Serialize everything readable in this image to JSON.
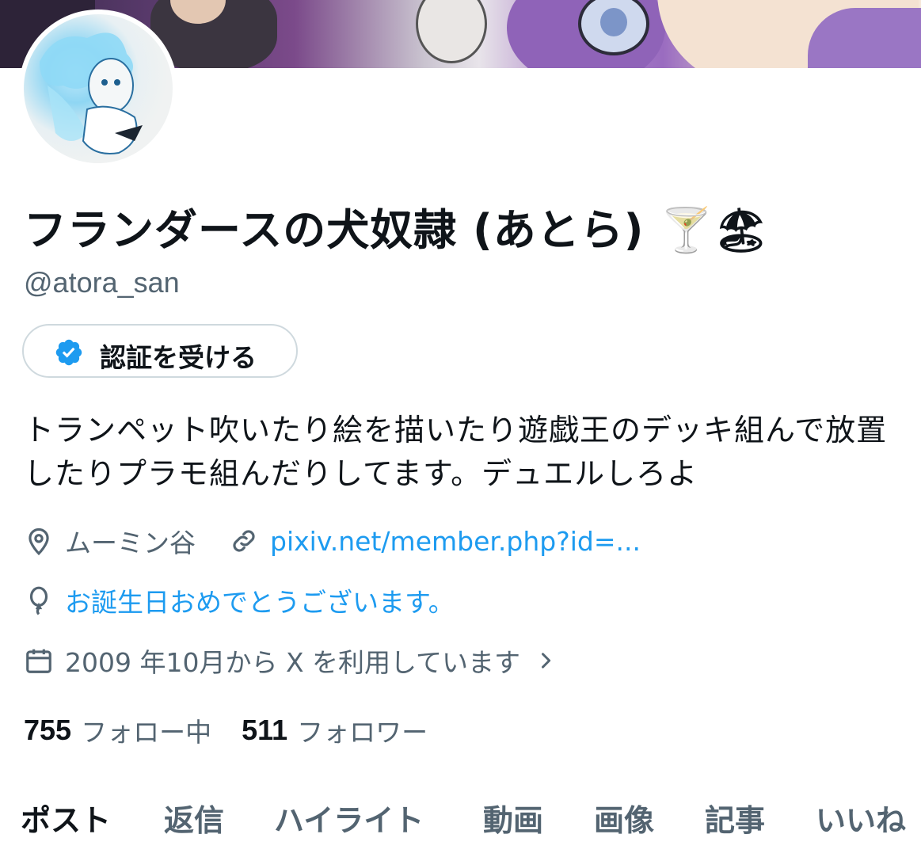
{
  "profile": {
    "display_name": "フランダースの犬奴隷 (あとら) 🍸🏖",
    "handle": "@atora_san",
    "verify_button_label": "認証を受ける",
    "bio": "トランペット吹いたり絵を描いたり遊戯王のデッキ組んで放置したりプラモ組んだりしてます。デュエルしろよ",
    "location": "ムーミン谷",
    "website": "pixiv.net/member.php?id=...",
    "birthday": "お誕生日おめでとうございます。",
    "joined": "2009 年10月から X を利用しています",
    "following_count": "755",
    "following_label": "フォロー中",
    "followers_count": "511",
    "followers_label": "フォロワー"
  },
  "tabs": [
    {
      "label": "ポスト",
      "active": true
    },
    {
      "label": "返信",
      "active": false
    },
    {
      "label": "ハイライト",
      "active": false
    },
    {
      "label": "動画",
      "active": false
    },
    {
      "label": "画像",
      "active": false
    },
    {
      "label": "記事",
      "active": false
    },
    {
      "label": "いいね",
      "active": false
    }
  ],
  "icons": {
    "verify": "verified-badge-icon",
    "location": "location-pin-icon",
    "link": "link-icon",
    "birthday": "balloon-icon",
    "joined": "calendar-icon",
    "chevron": "chevron-right-icon"
  },
  "colors": {
    "accent": "#1d9bf0",
    "text": "#0f1419",
    "muted": "#536471",
    "border": "#cfd9de"
  }
}
